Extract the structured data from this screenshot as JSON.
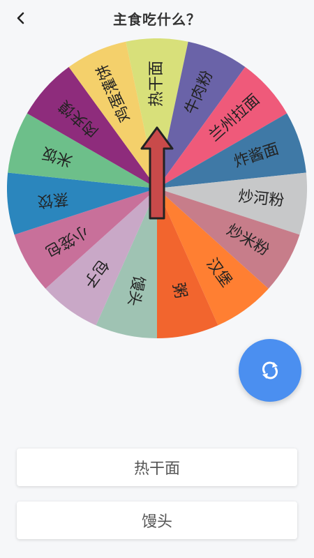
{
  "header": {
    "title": "主食吃什么？",
    "back_icon": "chevron-left-icon"
  },
  "wheel": {
    "center_arrow_color": "#c94a4a",
    "segments": [
      {
        "label": "热干面",
        "color": "#d8e07a"
      },
      {
        "label": "牛肉粉",
        "color": "#6a63a8"
      },
      {
        "label": "兰州拉面",
        "color": "#ef5a7a"
      },
      {
        "label": "炸酱面",
        "color": "#3f79a6"
      },
      {
        "label": "炒河粉",
        "color": "#c7c8c9"
      },
      {
        "label": "炒米粉",
        "color": "#c77d8a"
      },
      {
        "label": "汉堡",
        "color": "#ff7f32"
      },
      {
        "label": "粥",
        "color": "#f2652e"
      },
      {
        "label": "馒头",
        "color": "#9fc3b3"
      },
      {
        "label": "包子",
        "color": "#c9a8c7"
      },
      {
        "label": "小笼包",
        "color": "#c8709a"
      },
      {
        "label": "蒸饺",
        "color": "#2b86bd"
      },
      {
        "label": "米饭",
        "color": "#6dbf8a"
      },
      {
        "label": "肉夹馍",
        "color": "#8e2c7c"
      },
      {
        "label": "鸡蛋灌饼",
        "color": "#f4d06b"
      }
    ]
  },
  "spin_button": {
    "icon": "refresh-icon",
    "color": "#4b8ff0"
  },
  "results": [
    {
      "label": "热干面"
    },
    {
      "label": "馒头"
    }
  ]
}
